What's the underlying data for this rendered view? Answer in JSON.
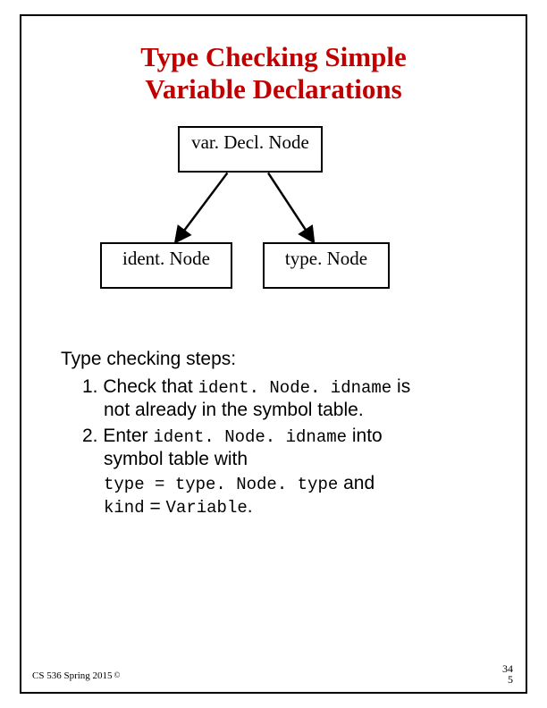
{
  "title_line1": "Type Checking Simple",
  "title_line2": "Variable Declarations",
  "diagram": {
    "top": "var. Decl. Node",
    "left": "ident. Node",
    "right": "type. Node"
  },
  "body": {
    "heading": "Type checking steps:",
    "step1_prefix": "1. Check that ",
    "step1_code": "ident. Node. idname",
    "step1_suffix": " is",
    "step1_line2": "not already in the symbol table.",
    "step2_prefix": "2. Enter ",
    "step2_code": "ident. Node. idname",
    "step2_suffix": " into",
    "step2_line2": "symbol table with",
    "step2_line3_code": "type = type. Node. type",
    "step2_line3_suffix": " and",
    "step2_line4_code1": "kind",
    "step2_line4_mid": " = ",
    "step2_line4_code2": "Variable",
    "step2_line4_suffix": "."
  },
  "footer": {
    "course": "CS 536  Spring 2015",
    "copyright": "©",
    "page1": "34",
    "page2": "5"
  }
}
